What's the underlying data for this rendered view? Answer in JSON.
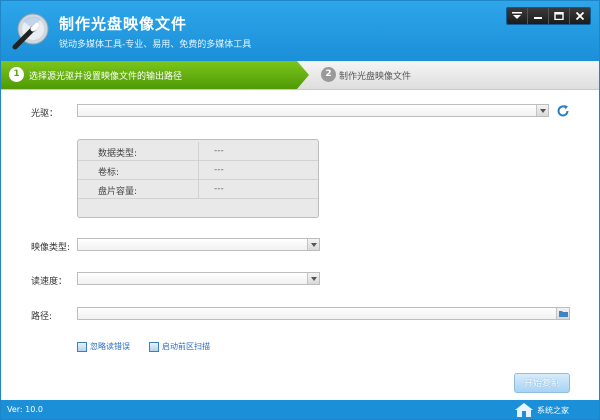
{
  "titlebar": {
    "title": "制作光盘映像文件",
    "subtitle": "锐动多媒体工具-专业、易用、免费的多媒体工具",
    "controls": [
      "menu-icon",
      "minimize-icon",
      "maximize-icon",
      "close-icon"
    ]
  },
  "steps": [
    {
      "number": "1",
      "label": "选择源光驱并设置映像文件的输出路径",
      "active": true
    },
    {
      "number": "2",
      "label": "制作光盘映像文件",
      "active": false
    }
  ],
  "form": {
    "drive_label": "光驱：",
    "drive_value": "",
    "refresh_icon": "refresh-icon",
    "info": [
      {
        "key": "数据类型:",
        "value": "---"
      },
      {
        "key": "卷标:",
        "value": "---"
      },
      {
        "key": "盘片容量:",
        "value": "---"
      }
    ],
    "image_type_label": "映像类型:",
    "image_type_value": "",
    "read_speed_label": "读速度：",
    "read_speed_value": "",
    "path_label": "路径:",
    "path_value": "",
    "checkboxes": [
      {
        "label": "忽略读错误",
        "checked": false
      },
      {
        "label": "启动前区扫描",
        "checked": false
      }
    ]
  },
  "actions": {
    "start_label": "开始复制"
  },
  "status": {
    "version": "Ver: 10.0"
  },
  "watermark": {
    "text": "系统之家"
  },
  "colors": {
    "title_blue": "#1b8fd8",
    "step_green": "#5fa50b",
    "link_blue": "#2a6cc1"
  }
}
